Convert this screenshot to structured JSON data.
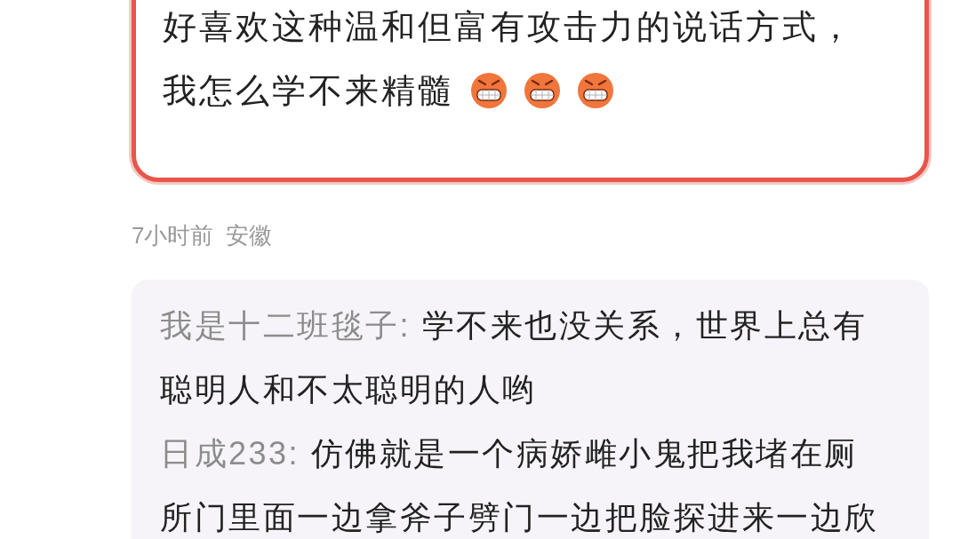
{
  "comment": {
    "lines": [
      "好喜欢这种温和但富有攻击力的说话方式，",
      "我怎么学不来精髓"
    ],
    "emojis": [
      {
        "kind": "grimace"
      },
      {
        "kind": "grimace"
      },
      {
        "kind": "grimace"
      }
    ]
  },
  "meta": {
    "time": "7小时前",
    "location": "安徽"
  },
  "replies": [
    {
      "author": "我是十二班毯子:",
      "text": "学不来也没关系，世界上总有聪明人和不太聪明的人哟"
    },
    {
      "author": "日成233:",
      "text": "仿佛就是一个病娇雌小鬼把我堵在厕所门里面一边拿斧子劈门一边把脸探进来一边欣"
    }
  ]
}
